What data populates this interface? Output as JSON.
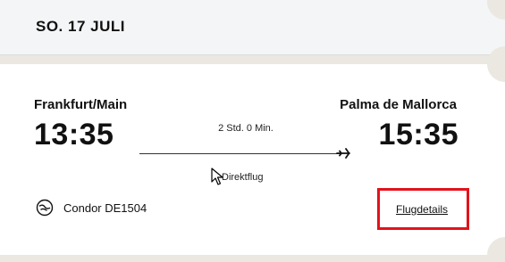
{
  "header": {
    "date": "SO. 17 JULI"
  },
  "flight": {
    "origin_city": "Frankfurt/Main",
    "destination_city": "Palma de Mallorca",
    "departure_time": "13:35",
    "arrival_time": "15:35",
    "duration": "2 Std. 0 Min.",
    "flight_type": "Direktflug",
    "airline": "Condor DE1504",
    "details_link": "Flugdetails"
  },
  "icons": {
    "plane": "plane-icon",
    "airline": "condor-logo-icon",
    "cursor": "mouse-cursor-icon"
  },
  "colors": {
    "highlight": "#e3121b",
    "background": "#ebe8e1"
  }
}
